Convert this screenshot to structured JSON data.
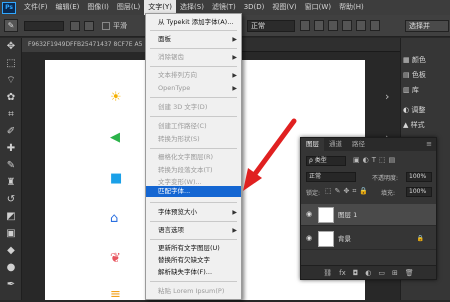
{
  "menubar": {
    "logo": "Ps",
    "items": [
      "文件(F)",
      "编辑(E)",
      "图像(I)",
      "图层(L)",
      "文字(Y)",
      "选择(S)",
      "滤镜(T)",
      "3D(D)",
      "视图(V)",
      "窗口(W)",
      "帮助(H)"
    ],
    "active_index": 4
  },
  "options": {
    "smooth_label": "平滑",
    "mode_value": "正常",
    "select_label": "选择并"
  },
  "document": {
    "tab_title": "F9632F1949DFFB25471437 8CF7E A5"
  },
  "type_menu": {
    "items": [
      {
        "label": "从 Typekit 添加字体(A)...",
        "disabled": false
      },
      {
        "label": "面板",
        "disabled": false,
        "submenu": true
      },
      {
        "label": "消除锯齿",
        "disabled": true,
        "submenu": true
      },
      {
        "label": "文本排列方向",
        "disabled": true,
        "submenu": true
      },
      {
        "label": "OpenType",
        "disabled": true,
        "submenu": true
      },
      {
        "label": "创建 3D 文字(D)",
        "disabled": true
      },
      {
        "label": "创建工作路径(C)",
        "disabled": true
      },
      {
        "label": "转换为形状(S)",
        "disabled": true
      },
      {
        "label": "栅格化文字图层(R)",
        "disabled": true
      },
      {
        "label": "转换为段落文本(T)",
        "disabled": true
      },
      {
        "label": "文字变形(W)...",
        "disabled": true
      },
      {
        "label": "匹配字体...",
        "disabled": false,
        "highlighted": true
      },
      {
        "label": "字体预览大小",
        "disabled": false,
        "submenu": true
      },
      {
        "label": "语言选项",
        "disabled": false,
        "submenu": true
      },
      {
        "label": "更新所有文字图层(U)",
        "disabled": false
      },
      {
        "label": "替换所有欠缺文字",
        "disabled": false
      },
      {
        "label": "解析缺失字体(F)...",
        "disabled": false
      },
      {
        "label": "粘贴 Lorem Ipsum(P)",
        "disabled": true
      }
    ]
  },
  "right_panel": {
    "items": [
      {
        "icon": "▦",
        "label": "颜色"
      },
      {
        "icon": "▤",
        "label": "色板"
      },
      {
        "icon": "▥",
        "label": "库"
      },
      {
        "icon": "◐",
        "label": "调整"
      },
      {
        "icon": "▲",
        "label": "样式"
      }
    ]
  },
  "layers_panel": {
    "tabs": [
      "图层",
      "通道",
      "路径"
    ],
    "kind_label": "ρ 类型",
    "blend_mode": "正常",
    "opacity_label": "不透明度:",
    "opacity_value": "100%",
    "lock_label": "锁定:",
    "fill_label": "填充:",
    "fill_value": "100%",
    "layers": [
      {
        "name": "图层 1",
        "selected": true
      },
      {
        "name": "背景",
        "selected": false,
        "locked": true
      }
    ]
  },
  "canvas_icons": [
    "☀",
    "◀",
    "■",
    "⌂",
    "❦",
    "≡"
  ],
  "colors": {
    "highlight": "#1466d2",
    "annotation_arrow": "#e02020",
    "ps_blue": "#31a8ff"
  }
}
